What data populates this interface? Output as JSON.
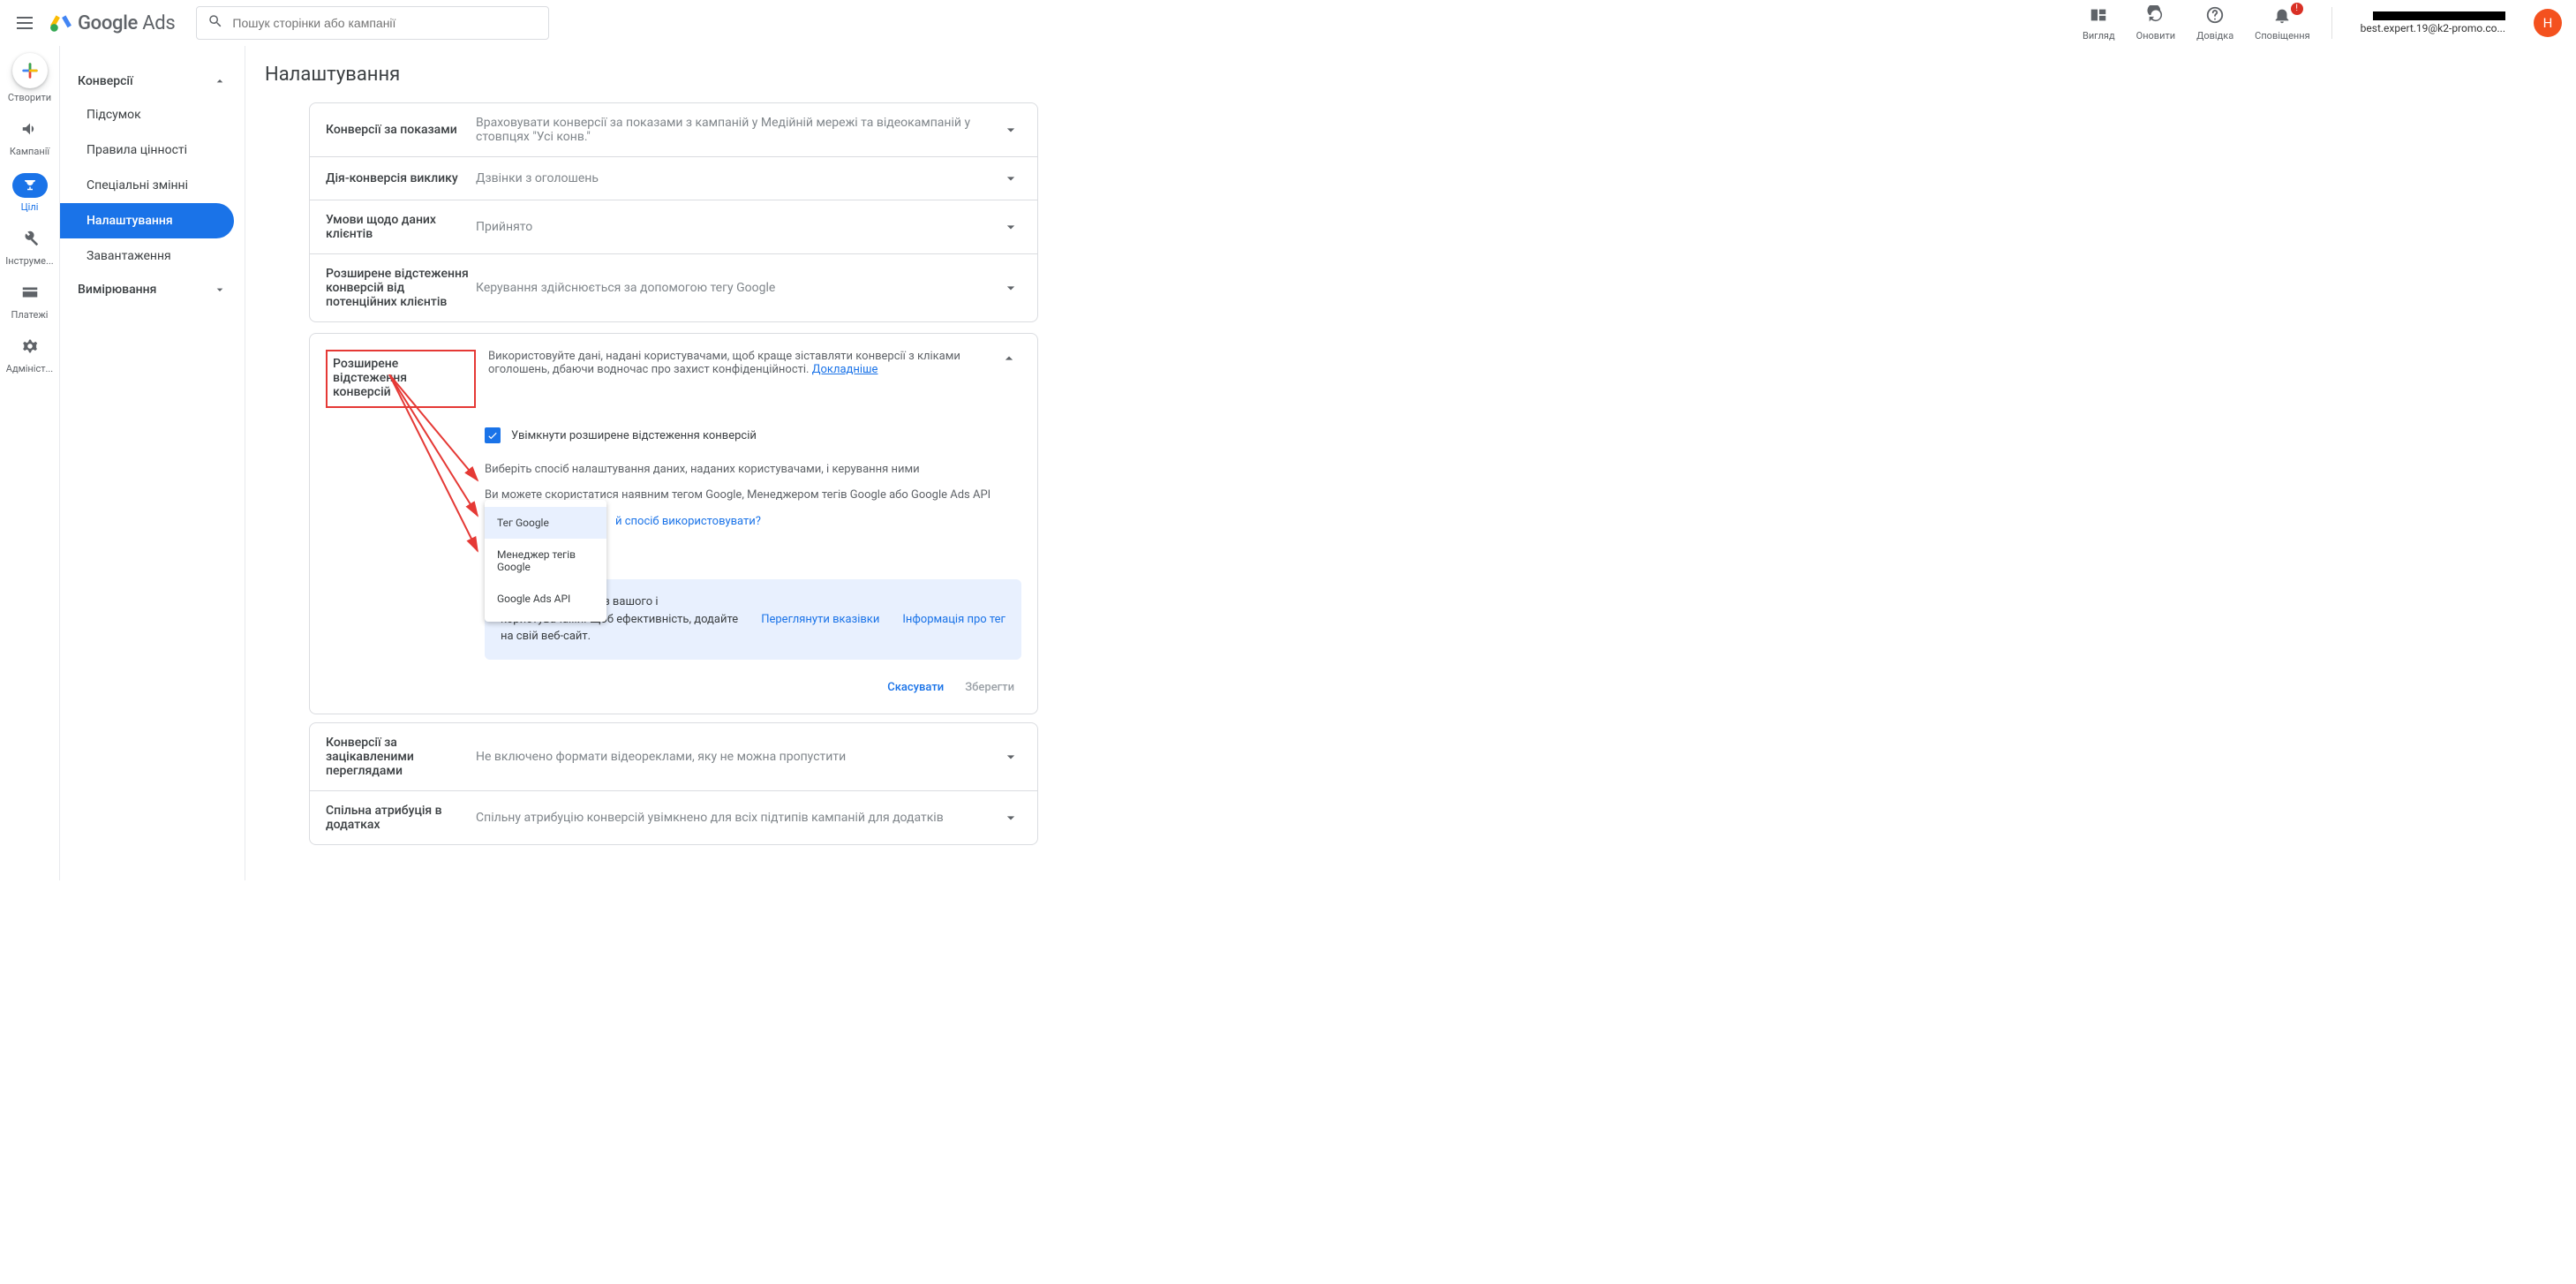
{
  "topbar": {
    "logo_main": "Google",
    "logo_sub": "Ads",
    "search_placeholder": "Пошук сторінки або кампанії",
    "actions": {
      "appearance": "Вигляд",
      "refresh": "Оновити",
      "help": "Довідка",
      "notifications": "Сповіщення",
      "notif_badge": "!"
    },
    "account_email": "best.expert.19@k2-promo.co...",
    "avatar_letter": "Н"
  },
  "rail": {
    "create": "Створити",
    "campaigns": "Кампанії",
    "goals": "Цілі",
    "tools": "Інструме...",
    "payments": "Платежі",
    "admin": "Адмініст..."
  },
  "sidebar": {
    "section_conversions": "Конверсії",
    "items": {
      "summary": "Підсумок",
      "value_rules": "Правила цінності",
      "custom_vars": "Спеціальні змінні",
      "settings": "Налаштування",
      "uploads": "Завантаження"
    },
    "section_measurement": "Вимірювання"
  },
  "page": {
    "title": "Налаштування"
  },
  "rows": {
    "r1": {
      "title": "Конверсії за показами",
      "desc": "Враховувати конверсії за показами з кампаній у Медійній мережі та відеокампаній у стовпцях \"Усі конв.\""
    },
    "r2": {
      "title": "Дія-конверсія виклику",
      "desc": "Дзвінки з оголошень"
    },
    "r3": {
      "title": "Умови щодо даних клієнтів",
      "desc": "Прийнято"
    },
    "r4": {
      "title": "Розширене відстеження конверсій від потенційних клієнтів",
      "desc": "Керування здійснюється за допомогою тегу Google"
    }
  },
  "expanded": {
    "title": "Розширене відстеження конверсій",
    "intro": "Використовуйте дані, надані користувачами, щоб краще зіставляти конверсії з кліками оголошень, дбаючи водночас про захист конфіденційності.",
    "learn_more": "Докладніше",
    "checkbox_label": "Увімкнути розширене відстеження конверсій",
    "choose_method": "Виберіть спосіб налаштування даних, наданих користувачами, і керування ними",
    "use_existing": "Ви можете скористатися наявним тегом Google, Менеджером тегів Google або Google Ads API",
    "which_method": "й спосіб використовувати?",
    "dropdown": {
      "opt1": "Тег Google",
      "opt2": "Менеджер тегів Google",
      "opt3": "Google Ads API"
    },
    "info_text": "о виявлятиме дані з вашого і користувачами. Щоб ефективність, додайте на свій веб-сайт.",
    "info_link1": "Переглянути вказівки",
    "info_link2": "Інформація про тег",
    "cancel": "Скасувати",
    "save": "Зберегти"
  },
  "rows2": {
    "r5": {
      "title": "Конверсії за зацікавленими переглядами",
      "desc": "Не включено формати відеореклами, яку не можна пропустити"
    },
    "r6": {
      "title": "Спільна атрибуція в додатках",
      "desc": "Спільну атрибуцію конверсій увімкнено для всіх підтипів кампаній для додатків"
    }
  }
}
